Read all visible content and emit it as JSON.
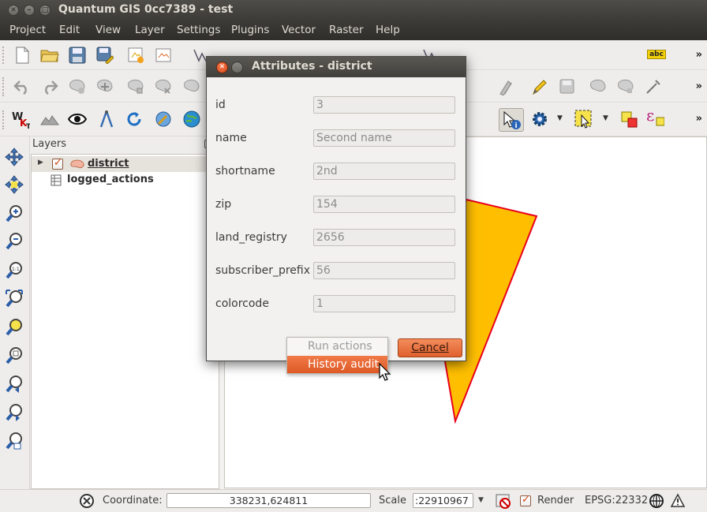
{
  "window": {
    "title": "Quantum GIS 0cc7389 - test",
    "close_glyph": "✕",
    "min_glyph": "–",
    "max_glyph": "□"
  },
  "menu": [
    "Project",
    "Edit",
    "View",
    "Layer",
    "Settings",
    "Plugins",
    "Vector",
    "Raster",
    "Help"
  ],
  "toolbar_overflow": "»",
  "icons": {
    "row1": [
      "new-project-icon",
      "open-project-icon",
      "save-project-icon",
      "save-as-icon",
      "new-print-composer-icon",
      "composer-manager-icon",
      "edit-pen-icon",
      "label-abc-icon"
    ],
    "row2": [
      "undo-icon",
      "redo-icon",
      "add-feature-icon",
      "move-feature-icon",
      "node-tool-icon",
      "delete-selected-icon",
      "cut-features-icon",
      "copy-features-icon",
      "paste-features-icon",
      "advanced-edit-icon"
    ],
    "row3": [
      "wkt-icon",
      "terrain-icon",
      "eye-icon",
      "compass-icon",
      "refresh-icon",
      "zoom-target-icon",
      "globe-icon",
      "identify-icon",
      "run-action-icon",
      "select-features-icon",
      "deselect-icon",
      "expression-select-icon"
    ],
    "left": [
      "pan-icon",
      "pan-to-selection-icon",
      "zoom-in-icon",
      "zoom-out-icon",
      "zoom-actual-icon",
      "zoom-full-icon",
      "zoom-to-layer-icon",
      "zoom-to-selection-icon",
      "zoom-last-icon",
      "zoom-next-icon",
      "refresh-map-icon"
    ],
    "abc_label": "abc"
  },
  "layers": {
    "title": "Layers",
    "items": [
      {
        "name": "district",
        "checked": true,
        "selected": true
      },
      {
        "name": "logged_actions",
        "checked": false,
        "selected": false
      }
    ]
  },
  "dialog": {
    "title": "Attributes - district",
    "fields": [
      {
        "label": "id",
        "value": "3"
      },
      {
        "label": "name",
        "value": "Second name"
      },
      {
        "label": "shortname",
        "value": "2nd"
      },
      {
        "label": "zip",
        "value": "154"
      },
      {
        "label": "land_registry",
        "value": "2656"
      },
      {
        "label": "subscriber_prefix",
        "value": "56"
      },
      {
        "label": "colorcode",
        "value": "1"
      }
    ],
    "cancel_label": "Cancel"
  },
  "popup": {
    "items": [
      "Run actions",
      "History audit"
    ],
    "highlighted": "History audit"
  },
  "status": {
    "coordinate_label": "Coordinate:",
    "coordinate_value": "338231,624811",
    "scale_label": "Scale",
    "scale_value": ":22910967",
    "render_label": "Render",
    "render_checked": true,
    "crs": "EPSG:22332"
  },
  "colors": {
    "accent": "#e6582a",
    "polygon_fill": "#ffbf00",
    "polygon_stroke": "#e8001c",
    "selection_bg": "#e6e2dc"
  }
}
